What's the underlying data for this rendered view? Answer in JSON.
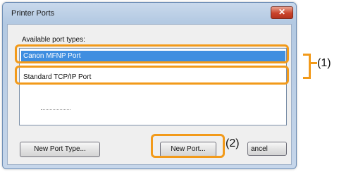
{
  "window": {
    "title": "Printer Ports",
    "close_label": "✕"
  },
  "dialog": {
    "available_label": "Available port types:",
    "port_types": [
      "Canon MFNP Port",
      "Standard TCP/IP Port"
    ],
    "selected_index": 0
  },
  "buttons": {
    "new_port_type": "New Port Type...",
    "new_port": "New Port...",
    "cancel_partial": "ancel"
  },
  "callouts": {
    "one": "(1)",
    "two": "(2)"
  },
  "colors": {
    "highlight": "#f29a1a",
    "selection": "#3f8ee0"
  }
}
